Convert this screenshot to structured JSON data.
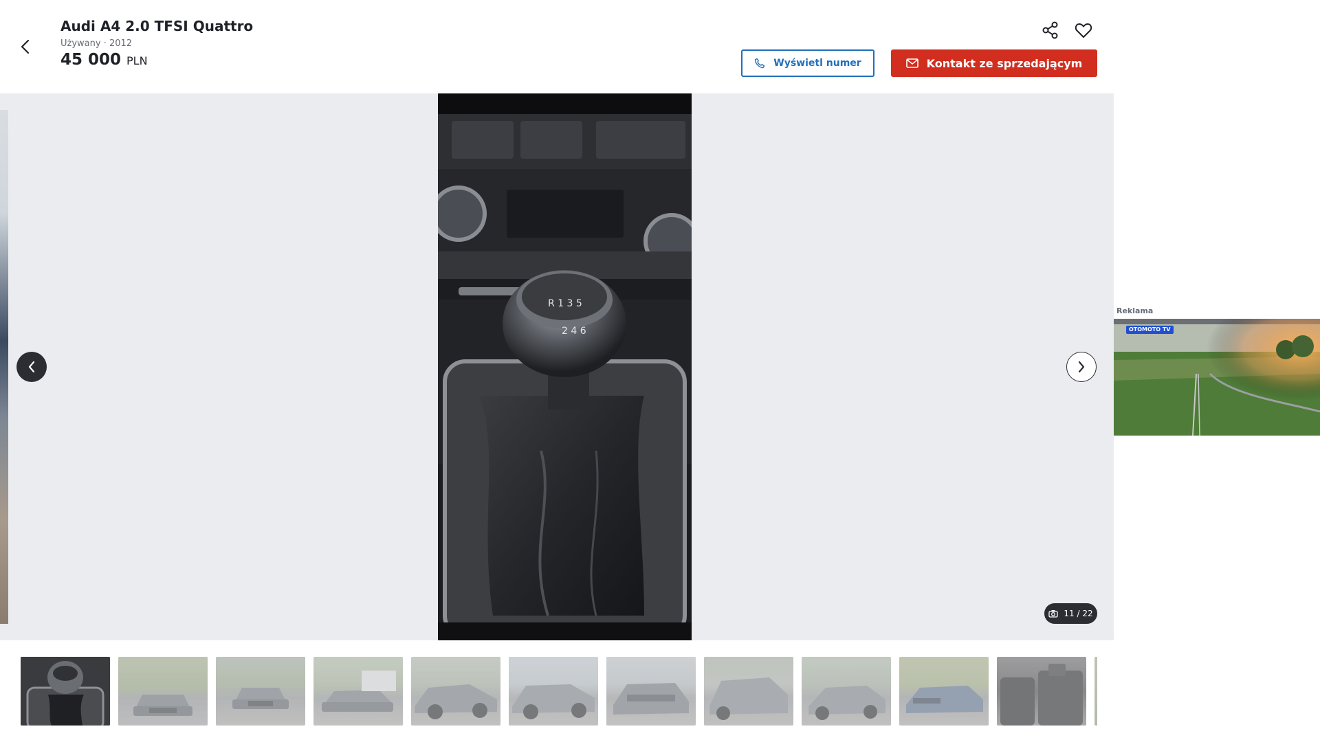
{
  "header": {
    "title": "Audi A4 2.0 TFSI Quattro",
    "meta": "Używany · 2012",
    "price_value": "45 000",
    "price_currency": "PLN",
    "phone_button": "Wyświetl numer",
    "contact_button": "Kontakt ze sprzedającym"
  },
  "gallery": {
    "counter": "11 / 22",
    "current_index": 11,
    "total": 22
  },
  "thumbnails": [
    {
      "kind": "gear-knob"
    },
    {
      "kind": "car-front"
    },
    {
      "kind": "car-front"
    },
    {
      "kind": "car-front-angle"
    },
    {
      "kind": "car-side"
    },
    {
      "kind": "car-side"
    },
    {
      "kind": "car-rear"
    },
    {
      "kind": "car-rear-angle"
    },
    {
      "kind": "car-side"
    },
    {
      "kind": "car-front-angle"
    },
    {
      "kind": "interior-rear-seats"
    },
    {
      "kind": "partial"
    }
  ],
  "ad": {
    "label": "Reklama",
    "badge": "OTOMOTO TV"
  },
  "colors": {
    "primary_blue": "#1f6fba",
    "cta_red": "#d12e1f",
    "gallery_bg": "#ebecef",
    "dark": "#2c2d33"
  },
  "icons": [
    "back-arrow-icon",
    "share-icon",
    "heart-icon",
    "phone-icon",
    "mail-icon",
    "chevron-left-icon",
    "chevron-right-icon",
    "camera-icon"
  ]
}
